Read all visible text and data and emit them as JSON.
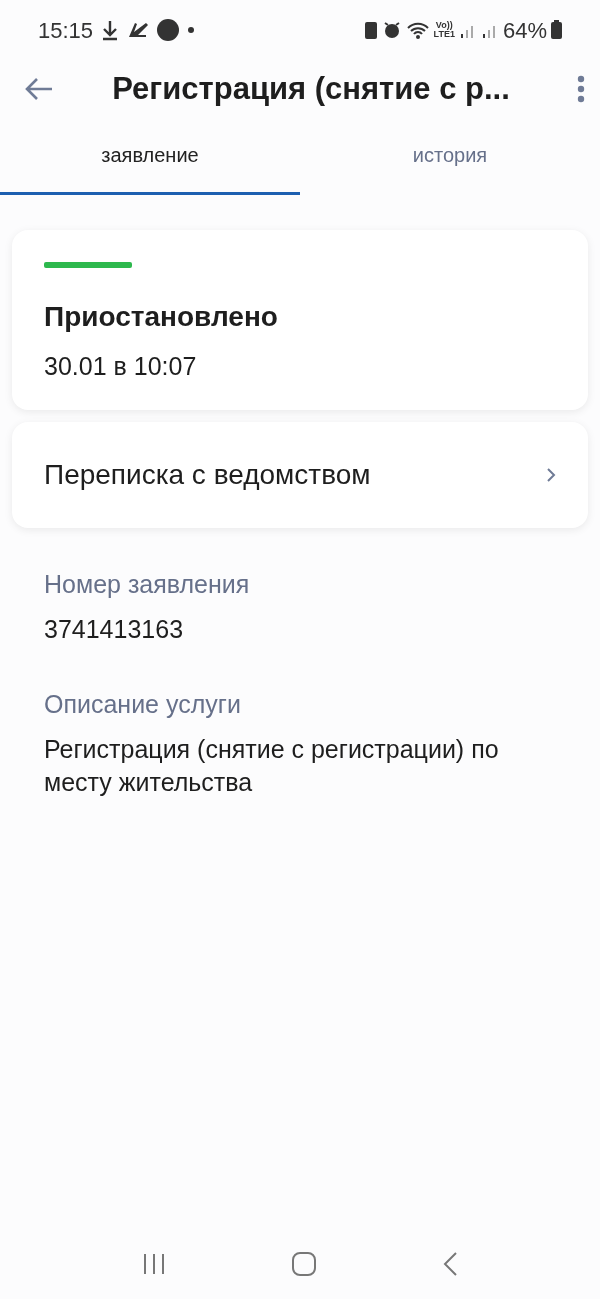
{
  "status_bar": {
    "time": "15:15",
    "network_label_top": "Vo))",
    "network_label_bottom": "LTE1",
    "battery": "64%"
  },
  "header": {
    "title": "Регистрация (снятие с р..."
  },
  "tabs": [
    {
      "label": "заявление",
      "selected": true
    },
    {
      "label": "история",
      "selected": false
    }
  ],
  "status_card": {
    "color": "#2db84d",
    "title": "Приостановлено",
    "date": "30.01 в 10:07"
  },
  "link_card": {
    "title": "Переписка с ведомством"
  },
  "fields": [
    {
      "label": "Номер заявления",
      "value": "3741413163"
    },
    {
      "label": "Описание услуги",
      "value": "Регистрация (снятие с регистрации) по месту жительства"
    }
  ]
}
